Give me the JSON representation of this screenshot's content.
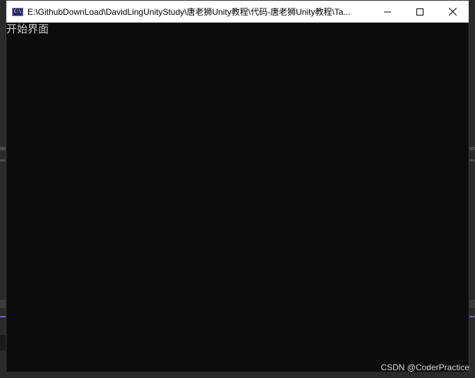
{
  "window": {
    "title": "E:\\GithubDownLoad\\DavidLingUnityStudy\\唐老狮Unity教程\\代码-唐老狮Unity教程\\Ta...",
    "icon": "console-icon",
    "icon_text": "C:\\",
    "controls": [
      "minimize-icon",
      "maximize-icon",
      "close-icon"
    ]
  },
  "console": {
    "lines": [
      "开始界面"
    ]
  },
  "watermark": "CSDN @CoderPractice",
  "colors": {
    "console_bg": "#0c0c0c",
    "console_text": "#cccccc",
    "titlebar_bg": "#ffffff",
    "accent": "#6b5fd0"
  }
}
